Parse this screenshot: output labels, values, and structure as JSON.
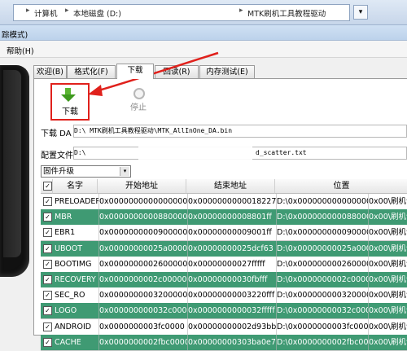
{
  "address_bar": {
    "crumbs": [
      "计算机",
      "本地磁盘 (D:)",
      "MTK刷机工具教程驱动"
    ],
    "separator": "▸",
    "dropdown": "▾"
  },
  "window": {
    "title": "踪模式)"
  },
  "menu": {
    "help": "帮助(H)"
  },
  "tabs": [
    {
      "label": "欢迎(B)"
    },
    {
      "label": "格式化(F)"
    },
    {
      "label": "下载"
    },
    {
      "label": "回读(R)"
    },
    {
      "label": "内存测试(E)"
    }
  ],
  "toolbar": {
    "download_label": "下载",
    "stop_label": "停止"
  },
  "download_da": {
    "label": "下载 DA",
    "value": "D:\\                        MTK刷机工具教程驱动\\MTK_AllInOne_DA.bin"
  },
  "scatter_file": {
    "label": "配置文件",
    "value_start": "D:\\",
    "value_end": "d_scatter.txt"
  },
  "mode_select": {
    "value": "固件升级",
    "dropdown": "▾"
  },
  "table": {
    "headers": [
      "名字",
      "开始地址",
      "结束地址",
      "位置"
    ],
    "check_mark": "✓",
    "rows": [
      {
        "name": "PRELOADER",
        "start": "0x0000000000000000",
        "end": "0x0000000000018227",
        "loc1": "D:\\0x0000000000000000",
        "loc2": "0x00\\刷机包\\",
        "style": "w"
      },
      {
        "name": "MBR",
        "start": "0x0000000000880000",
        "end": "0x00000000008801ff",
        "loc1": "D:\\0x0000000000880000",
        "loc2": "0x00\\刷机包\\",
        "style": "g"
      },
      {
        "name": "EBR1",
        "start": "0x0000000000900000",
        "end": "0x00000000009001ff",
        "loc1": "D:\\0x0000000000900000",
        "loc2": "0x00\\刷机包\\",
        "style": "w"
      },
      {
        "name": "UBOOT",
        "start": "0x00000000025a0000",
        "end": "0x00000000025dcf63",
        "loc1": "D:\\0x00000000025a0000",
        "loc2": "0x00\\刷机包\\",
        "style": "g"
      },
      {
        "name": "BOOTIMG",
        "start": "0x0000000002600000",
        "end": "0x00000000027fffff",
        "loc1": "D:\\0x0000000002600000",
        "loc2": "0x00\\刷机包\\",
        "style": "w"
      },
      {
        "name": "RECOVERY",
        "start": "0x0000000002c00000",
        "end": "0x00000000030fbfff",
        "loc1": "D:\\0x0000000002c00000",
        "loc2": "0x00\\刷机包\\",
        "style": "g"
      },
      {
        "name": "SEC_RO",
        "start": "0x0000000003200000",
        "end": "0x00000000003220fff",
        "loc1": "D:\\0x0000000003200000",
        "loc2": "0x00\\刷机包\\",
        "style": "w"
      },
      {
        "name": "LOGO",
        "start": "0x000000000032c0000",
        "end": "0x0000000000032fffff",
        "loc1": "D:\\0x00000000032c0000",
        "loc2": "0x00\\刷机包\\",
        "style": "g"
      },
      {
        "name": "ANDROID",
        "start": "0x0000000003fc0000",
        "end": "0x00000000002d93bbb7",
        "loc1": "D:\\0x0000000003fc0000",
        "loc2": "0x00\\刷机包\\",
        "style": "w"
      },
      {
        "name": "CACHE",
        "start": "0x0000000002fbc0000",
        "end": "0x00000000303ba0e7",
        "loc1": "D:\\0x0000000002fbc0000",
        "loc2": "0x00\\刷机包\\",
        "style": "g"
      }
    ]
  },
  "colors": {
    "highlight_row": "#3f9a73",
    "annotation": "#e0211c",
    "download_icon": "#5bb531"
  }
}
